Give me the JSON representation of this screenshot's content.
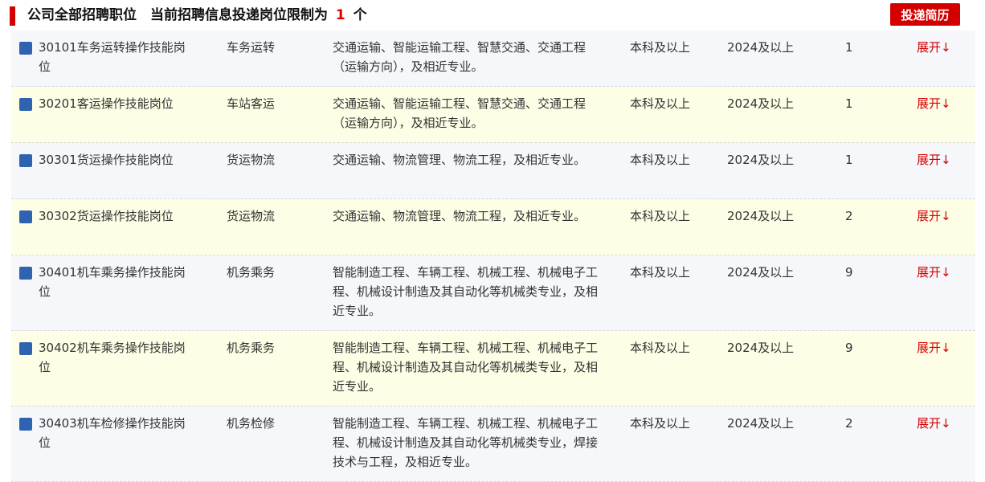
{
  "header": {
    "title_prefix": "公司全部招聘职位　当前招聘信息投递岗位限制为",
    "limit": "1",
    "unit": "个",
    "apply_label": "投递简历"
  },
  "rows": [
    {
      "name": "30101车务运转操作技能岗位",
      "type": "车务运转",
      "major": "交通运输、智能运输工程、智慧交通、交通工程（运输方向），及相近专业。",
      "education": "本科及以上",
      "year": "2024及以上",
      "count": "1",
      "expand": "展开↓"
    },
    {
      "name": "30201客运操作技能岗位",
      "type": "车站客运",
      "major": "交通运输、智能运输工程、智慧交通、交通工程（运输方向），及相近专业。",
      "education": "本科及以上",
      "year": "2024及以上",
      "count": "1",
      "expand": "展开↓"
    },
    {
      "name": "30301货运操作技能岗位",
      "type": "货运物流",
      "major": "交通运输、物流管理、物流工程，及相近专业。",
      "education": "本科及以上",
      "year": "2024及以上",
      "count": "1",
      "expand": "展开↓"
    },
    {
      "name": "30302货运操作技能岗位",
      "type": "货运物流",
      "major": "交通运输、物流管理、物流工程，及相近专业。",
      "education": "本科及以上",
      "year": "2024及以上",
      "count": "2",
      "expand": "展开↓"
    },
    {
      "name": "30401机车乘务操作技能岗位",
      "type": "机务乘务",
      "major": "智能制造工程、车辆工程、机械工程、机械电子工程、机械设计制造及其自动化等机械类专业，及相近专业。",
      "education": "本科及以上",
      "year": "2024及以上",
      "count": "9",
      "expand": "展开↓"
    },
    {
      "name": "30402机车乘务操作技能岗位",
      "type": "机务乘务",
      "major": "智能制造工程、车辆工程、机械工程、机械电子工程、机械设计制造及其自动化等机械类专业，及相近专业。",
      "education": "本科及以上",
      "year": "2024及以上",
      "count": "9",
      "expand": "展开↓"
    },
    {
      "name": "30403机车检修操作技能岗位",
      "type": "机务检修",
      "major": "智能制造工程、车辆工程、机械工程、机械电子工程、机械设计制造及其自动化等机械类专业，焊接技术与工程，及相近专业。",
      "education": "本科及以上",
      "year": "2024及以上",
      "count": "2",
      "expand": "展开↓"
    }
  ]
}
